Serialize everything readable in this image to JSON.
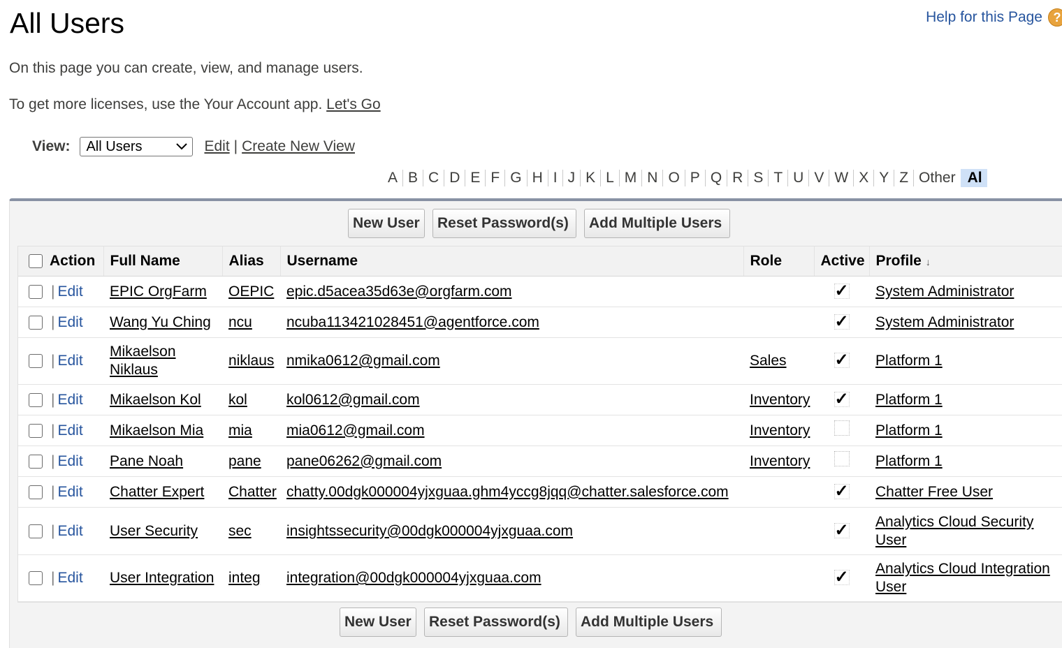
{
  "header": {
    "title": "All Users",
    "help_label": "Help for this Page",
    "help_icon": "?"
  },
  "intro": {
    "text": "On this page you can create, view, and manage users.",
    "license_text": "To get more licenses, use the Your Account app.",
    "license_link": "Let's Go"
  },
  "view": {
    "label": "View:",
    "selected": "All Users",
    "edit_link": "Edit",
    "separator": "|",
    "create_link": "Create New View"
  },
  "alphabet": [
    "A",
    "B",
    "C",
    "D",
    "E",
    "F",
    "G",
    "H",
    "I",
    "J",
    "K",
    "L",
    "M",
    "N",
    "O",
    "P",
    "Q",
    "R",
    "S",
    "T",
    "U",
    "V",
    "W",
    "X",
    "Y",
    "Z",
    "Other"
  ],
  "alphabet_selected": "Al",
  "buttons": {
    "new_user": "New User",
    "reset_password": "Reset Password(s)",
    "add_multiple": "Add Multiple Users"
  },
  "table": {
    "columns": {
      "action": "Action",
      "full_name": "Full Name",
      "alias": "Alias",
      "username": "Username",
      "role": "Role",
      "active": "Active",
      "profile": "Profile"
    },
    "sort_indicator": "↓",
    "edit_label": "Edit",
    "pipe": "|",
    "rows": [
      {
        "full_name": "EPIC OrgFarm",
        "alias": "OEPIC",
        "username": "epic.d5acea35d63e@orgfarm.com",
        "role": "",
        "active": true,
        "profile": "System Administrator"
      },
      {
        "full_name": "Wang Yu Ching",
        "alias": "ncu",
        "username": "ncuba113421028451@agentforce.com",
        "role": "",
        "active": true,
        "profile": "System Administrator"
      },
      {
        "full_name": "Mikaelson Niklaus",
        "alias": "niklaus",
        "username": "nmika0612@gmail.com",
        "role": "Sales",
        "active": true,
        "profile": "Platform 1"
      },
      {
        "full_name": "Mikaelson Kol",
        "alias": "kol",
        "username": "kol0612@gmail.com",
        "role": "Inventory",
        "active": true,
        "profile": "Platform 1"
      },
      {
        "full_name": "Mikaelson Mia",
        "alias": "mia",
        "username": "mia0612@gmail.com",
        "role": "Inventory",
        "active": false,
        "profile": "Platform 1"
      },
      {
        "full_name": "Pane Noah",
        "alias": "pane",
        "username": "pane06262@gmail.com",
        "role": "Inventory",
        "active": false,
        "profile": "Platform 1"
      },
      {
        "full_name": "Chatter Expert",
        "alias": "Chatter",
        "username": "chatty.00dgk000004yjxguaa.ghm4yccg8jqq@chatter.salesforce.com",
        "role": "",
        "active": true,
        "profile": "Chatter Free User"
      },
      {
        "full_name": "User Security",
        "alias": "sec",
        "username": "insightssecurity@00dgk000004yjxguaa.com",
        "role": "",
        "active": true,
        "profile": "Analytics Cloud Security User"
      },
      {
        "full_name": "User Integration",
        "alias": "integ",
        "username": "integration@00dgk000004yjxguaa.com",
        "role": "",
        "active": true,
        "profile": "Analytics Cloud Integration User"
      }
    ]
  },
  "icons": {
    "help": "question-circle-icon",
    "dropdown": "chevron-down-icon",
    "checkmark": "checkmark-icon",
    "sort": "arrow-down-icon"
  }
}
